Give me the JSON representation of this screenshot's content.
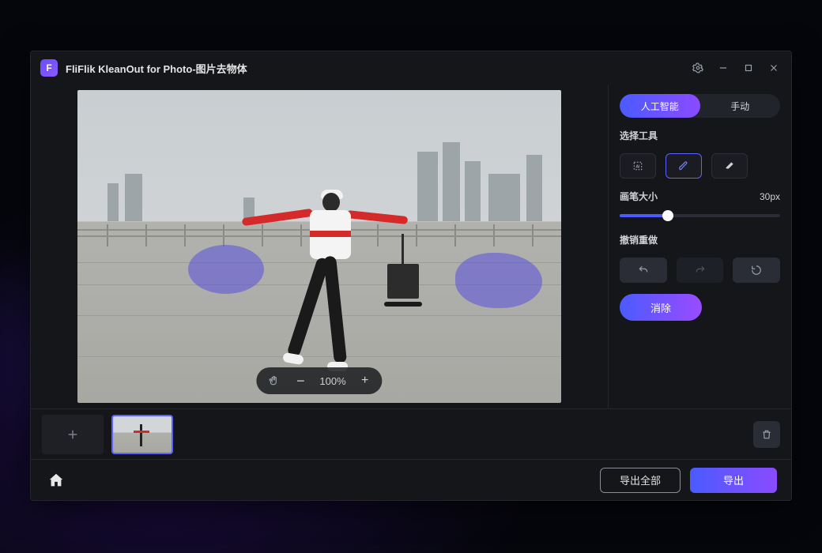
{
  "titlebar": {
    "title": "FliFlik KleanOut for Photo-图片去物体"
  },
  "viewer": {
    "zoom": "100%"
  },
  "side": {
    "tab_ai": "人工智能",
    "tab_manual": "手动",
    "select_tool": "选择工具",
    "brush_size_label": "画笔大小",
    "brush_size_value": "30px",
    "brush_size_pct": 30,
    "undo_redo": "撤销重做",
    "erase": "消除"
  },
  "footer": {
    "export_all": "导出全部",
    "export": "导出"
  },
  "icons": {
    "plus": "+",
    "minus": "−"
  }
}
